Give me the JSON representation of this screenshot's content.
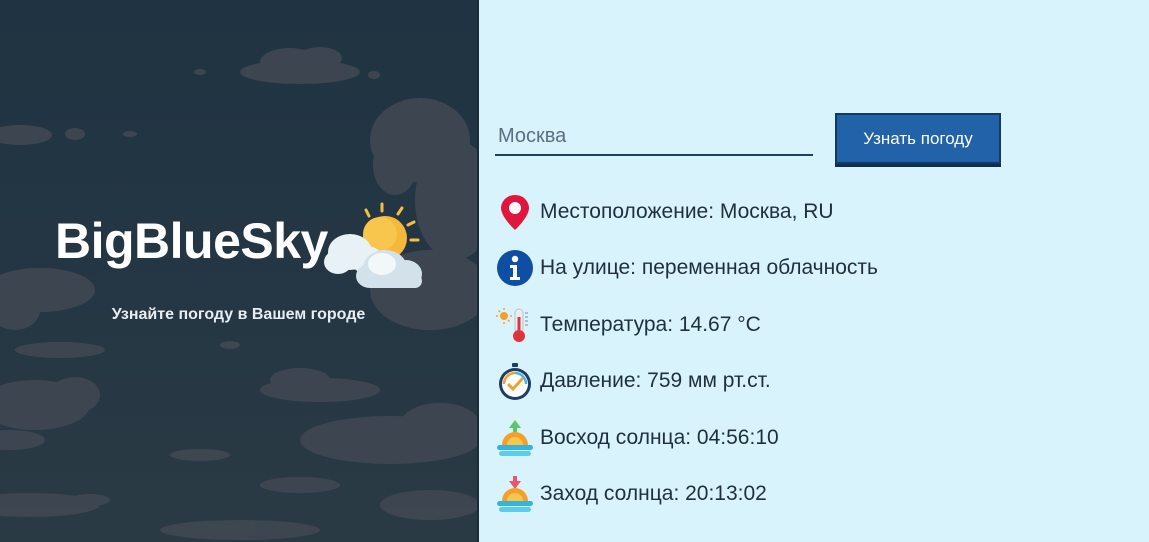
{
  "brand": {
    "title": "BigBlueSky",
    "tagline": "Узнайте погоду в Вашем городе",
    "icon": "sun-behind-cloud-icon"
  },
  "search": {
    "value": "Москва",
    "button_label": "Узнать погоду"
  },
  "weather": [
    {
      "icon": "location-pin-icon",
      "text": "Местоположение: Москва, RU"
    },
    {
      "icon": "info-icon",
      "text": "На улице: переменная облачность"
    },
    {
      "icon": "thermometer-icon",
      "text": "Температура: 14.67 °C"
    },
    {
      "icon": "barometer-icon",
      "text": "Давление: 759 мм рт.ст."
    },
    {
      "icon": "sunrise-icon",
      "text": "Восход солнца: 04:56:10"
    },
    {
      "icon": "sunset-icon",
      "text": "Заход солнца: 20:13:02"
    }
  ],
  "colors": {
    "left_panel": "#23333f",
    "right_panel": "#d9f3fd",
    "button": "#2162a9",
    "text": "#1f2f3e"
  }
}
